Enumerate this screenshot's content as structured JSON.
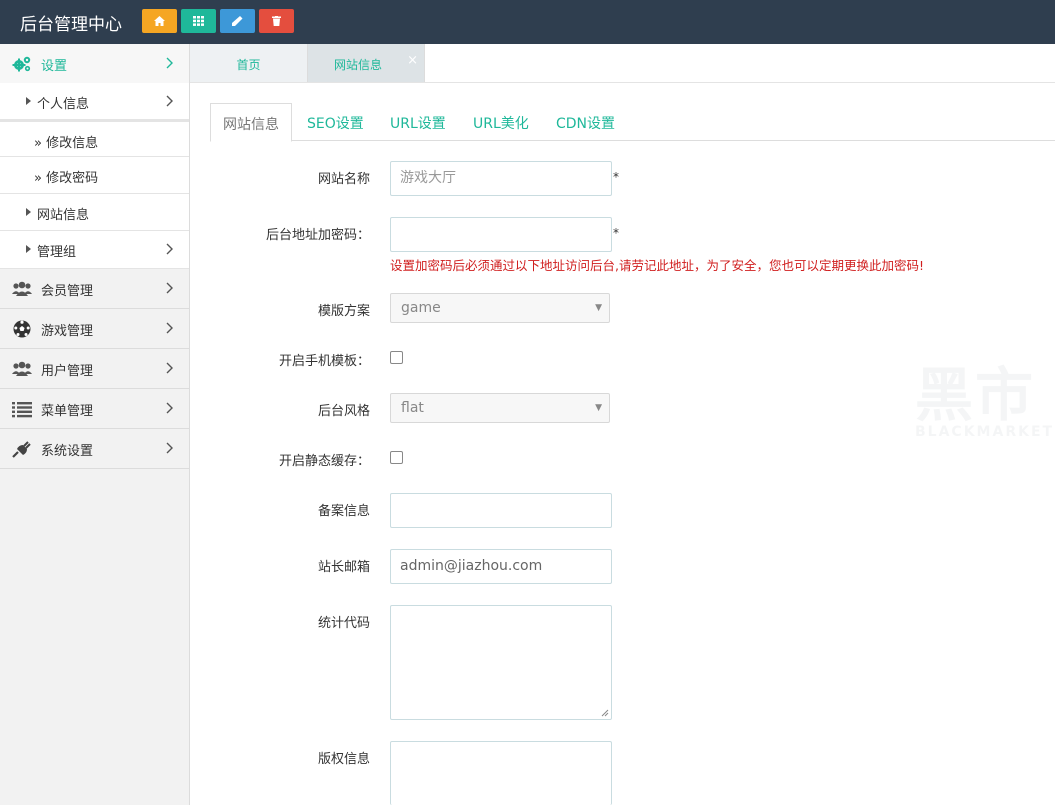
{
  "header": {
    "title": "后台管理中心",
    "quick_buttons": [
      {
        "name": "home-icon",
        "color": "#f5a623"
      },
      {
        "name": "grid-icon",
        "color": "#1fb89a"
      },
      {
        "name": "pencil-icon",
        "color": "#3d98d8"
      },
      {
        "name": "trash-icon",
        "color": "#e44e3e"
      }
    ]
  },
  "sidebar": {
    "items": [
      {
        "label": "设置",
        "icon": "gears-icon",
        "active": true
      },
      {
        "label": "会员管理",
        "icon": "users-icon"
      },
      {
        "label": "游戏管理",
        "icon": "soccer-ball-icon"
      },
      {
        "label": "用户管理",
        "icon": "users-icon"
      },
      {
        "label": "菜单管理",
        "icon": "list-icon"
      },
      {
        "label": "系统设置",
        "icon": "plug-icon"
      }
    ],
    "sub_items": [
      {
        "label": "个人信息"
      },
      {
        "label": "» 修改信息"
      },
      {
        "label": "» 修改密码"
      },
      {
        "label": "网站信息"
      },
      {
        "label": "管理组"
      }
    ]
  },
  "page_tabs": [
    {
      "label": "首页"
    },
    {
      "label": "网站信息",
      "close": "×"
    }
  ],
  "content_tabs": [
    {
      "label": "网站信息",
      "active": true
    },
    {
      "label": "SEO设置"
    },
    {
      "label": "URL设置"
    },
    {
      "label": "URL美化"
    },
    {
      "label": "CDN设置"
    }
  ],
  "form": {
    "site_name": {
      "label": "网站名称",
      "placeholder": "游戏大厅",
      "required_mark": "*"
    },
    "admin_code": {
      "label": "后台地址加密码：",
      "value": "",
      "required_mark": "*",
      "warning": "设置加密码后必须通过以下地址访问后台,请劳记此地址，为了安全，您也可以定期更换此加密码!"
    },
    "template": {
      "label": "模版方案",
      "value": "game"
    },
    "mobile_template": {
      "label": "开启手机模板：",
      "checked": false
    },
    "admin_style": {
      "label": "后台风格",
      "value": "flat"
    },
    "static_cache": {
      "label": "开启静态缓存：",
      "checked": false
    },
    "icp": {
      "label": "备案信息",
      "value": ""
    },
    "email": {
      "label": "站长邮箱",
      "value": "admin@jiazhou.com"
    },
    "stats_code": {
      "label": "统计代码",
      "value": ""
    },
    "copyright": {
      "label": "版权信息",
      "value": ""
    }
  },
  "watermark": {
    "big": "黑市",
    "small": "BLACKMARKET"
  }
}
